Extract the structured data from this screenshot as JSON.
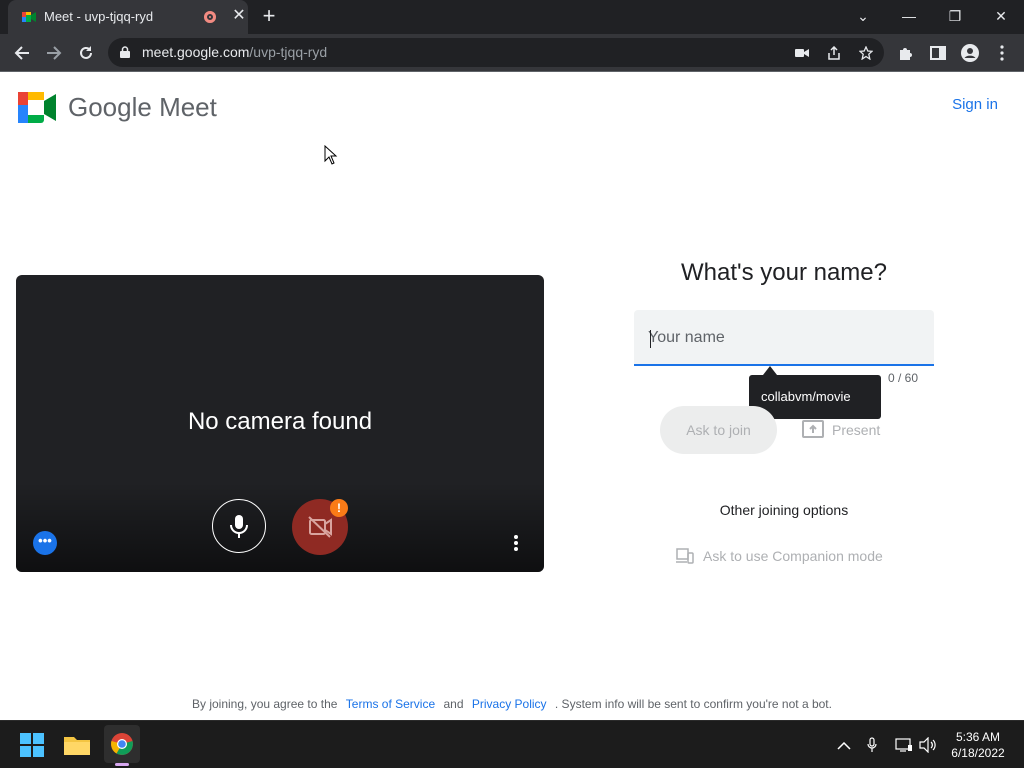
{
  "browser": {
    "tab_title": "Meet - uvp-tjqq-ryd",
    "tab_close_symbol": "✕",
    "new_tab_symbol": "+",
    "url_host": "meet.google.com",
    "url_path": "/uvp-tjqq-ryd",
    "window_minimize": "—",
    "window_restore": "❐",
    "window_close": "✕",
    "tab_dropdown": "⌄"
  },
  "header": {
    "brand": "Google Meet",
    "signin": "Sign in"
  },
  "preview": {
    "message": "No camera found",
    "camera_warning": "!",
    "effects_symbol": "•••"
  },
  "join": {
    "title": "What's your name?",
    "name_placeholder": "Your name",
    "name_value": "",
    "char_counter": "0 / 60",
    "autofill_suggestion": "collabvm/movie",
    "ask_to_join": "Ask to join",
    "present": "Present",
    "other_options": "Other joining options",
    "companion_mode": "Ask to use Companion mode"
  },
  "footer": {
    "prefix": "By joining, you agree to the",
    "terms": "Terms of Service",
    "and": "and",
    "privacy": "Privacy Policy",
    "suffix": ". System info will be sent to confirm you're not a bot."
  },
  "taskbar": {
    "time": "5:36 AM",
    "date": "6/18/2022"
  },
  "colors": {
    "accent": "#1a73e8",
    "camera_off": "#8f2a23",
    "warning": "#fa7b17"
  }
}
